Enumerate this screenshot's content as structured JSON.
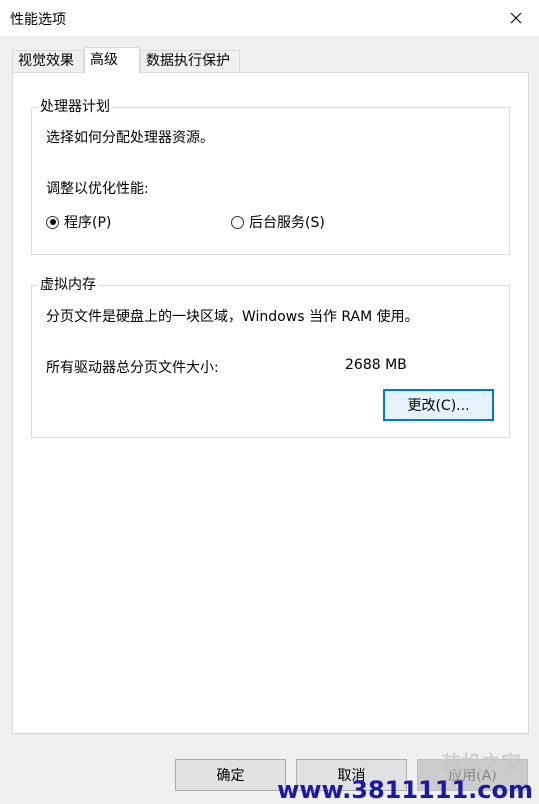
{
  "window": {
    "title": "性能选项"
  },
  "tabs": [
    {
      "label": "视觉效果",
      "active": false
    },
    {
      "label": "高级",
      "active": true
    },
    {
      "label": "数据执行保护",
      "active": false
    }
  ],
  "processor": {
    "legend": "处理器计划",
    "description": "选择如何分配处理器资源。",
    "adjust_label": "调整以优化性能:",
    "option_programs": "程序(P)",
    "option_background": "后台服务(S)",
    "selected": "programs"
  },
  "virtual_memory": {
    "legend": "虚拟内存",
    "description": "分页文件是硬盘上的一块区域，Windows 当作 RAM 使用。",
    "total_label": "所有驱动器总分页文件大小:",
    "total_value": "2688 MB",
    "change_button": "更改(C)..."
  },
  "footer": {
    "ok": "确定",
    "cancel": "取消",
    "apply": "应用(A)"
  },
  "watermark": {
    "url": "www.3811111.com",
    "cn": "装机之家"
  }
}
